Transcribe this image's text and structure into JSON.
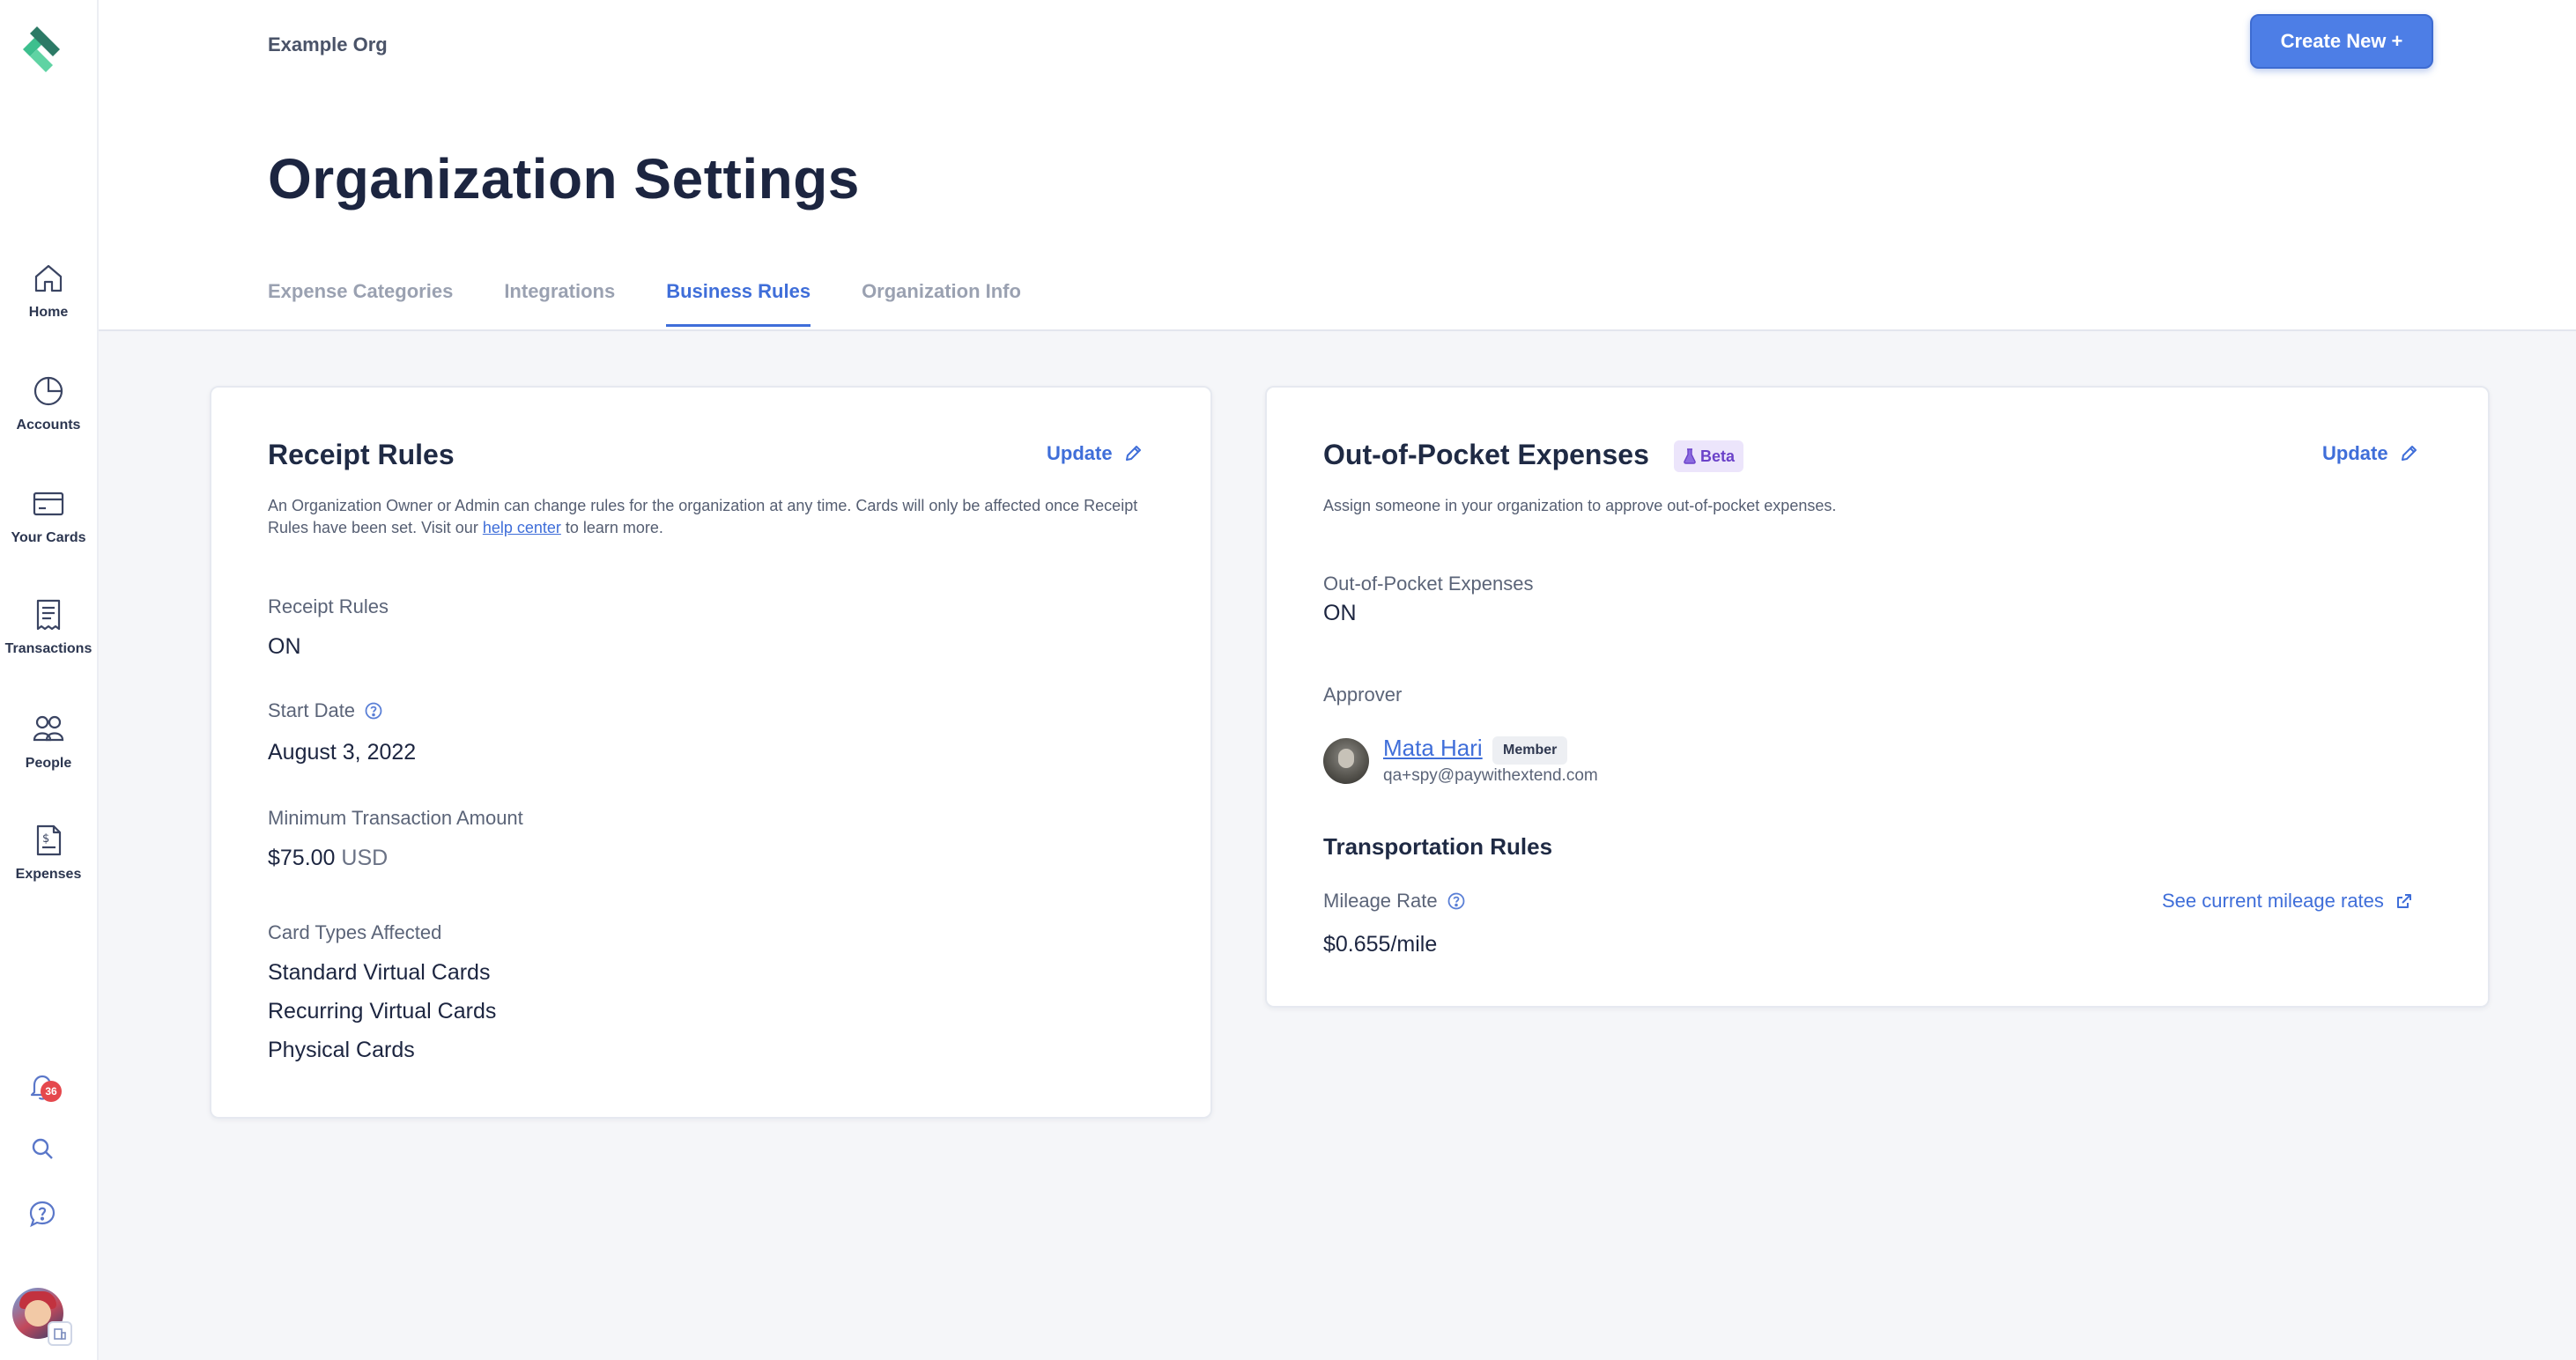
{
  "sidebar": {
    "items": [
      {
        "label": "Home",
        "icon": "home-icon"
      },
      {
        "label": "Accounts",
        "icon": "pie-chart-icon"
      },
      {
        "label": "Your Cards",
        "icon": "credit-card-icon"
      },
      {
        "label": "Transactions",
        "icon": "receipt-icon"
      },
      {
        "label": "People",
        "icon": "people-icon"
      },
      {
        "label": "Expenses",
        "icon": "expense-document-icon"
      }
    ],
    "notification_count": "36"
  },
  "header": {
    "org_name": "Example Org",
    "create_button": "Create New +",
    "title": "Organization Settings",
    "tabs": [
      {
        "label": "Expense Categories",
        "active": false
      },
      {
        "label": "Integrations",
        "active": false
      },
      {
        "label": "Business Rules",
        "active": true
      },
      {
        "label": "Organization Info",
        "active": false
      }
    ]
  },
  "receipt_card": {
    "title": "Receipt Rules",
    "update_label": "Update",
    "desc_before": "An Organization Owner or Admin can change rules for the organization at any time. Cards will only be affected once Receipt Rules have been set. Visit our ",
    "desc_link": "help center",
    "desc_after": " to learn more.",
    "rules_label": "Receipt Rules",
    "rules_value": "ON",
    "start_label": "Start Date",
    "start_value": "August 3, 2022",
    "min_label": "Minimum Transaction Amount",
    "min_value": "$75.00",
    "min_unit": "USD",
    "types_label": "Card Types Affected",
    "card_types": [
      "Standard Virtual Cards",
      "Recurring Virtual Cards",
      "Physical Cards"
    ]
  },
  "oop_card": {
    "title": "Out-of-Pocket Expenses",
    "beta_label": "Beta",
    "update_label": "Update",
    "desc": "Assign someone in your organization to approve out-of-pocket expenses.",
    "status_label": "Out-of-Pocket Expenses",
    "status_value": "ON",
    "approver_label": "Approver",
    "approver_name": "Mata Hari",
    "approver_role": "Member",
    "approver_email": "qa+spy@paywithextend.com",
    "transport_title": "Transportation Rules",
    "mileage_label": "Mileage Rate",
    "mileage_link": "See current mileage rates",
    "mileage_value": "$0.655/mile"
  },
  "colors": {
    "accent": "#3f6ed9",
    "brand_green": "#3dbf8e",
    "beta_purple": "#6b42c9",
    "badge_red": "#e5484d"
  }
}
